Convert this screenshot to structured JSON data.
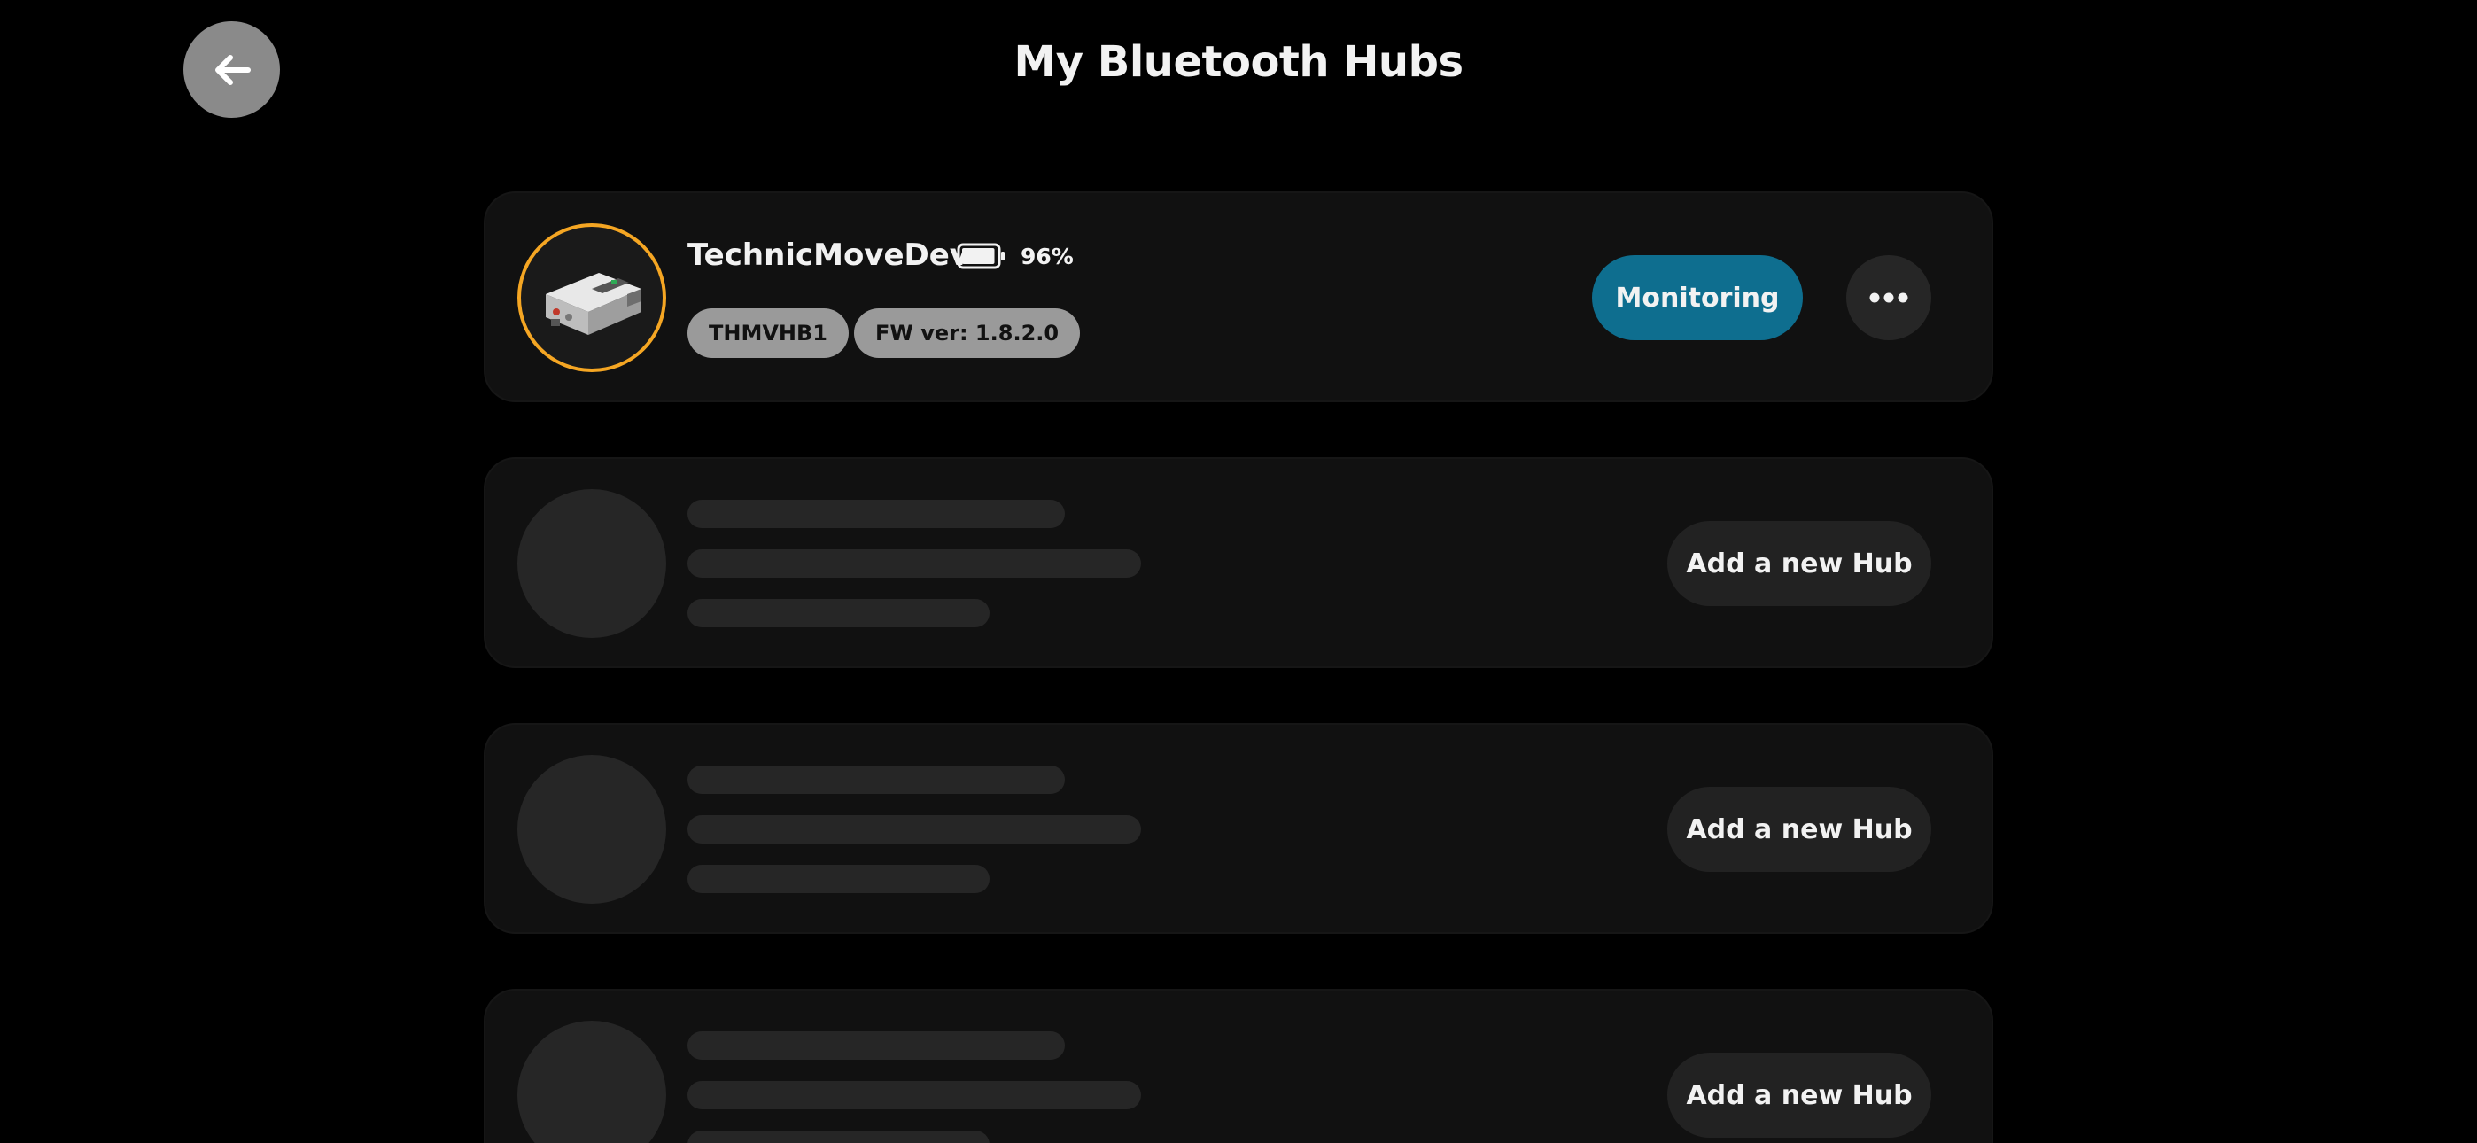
{
  "header": {
    "title": "My Bluetooth Hubs",
    "back_icon": "arrow-left-icon"
  },
  "connected_hub": {
    "name": "TechnicMoveDev",
    "battery_percent_label": "96%",
    "battery_level": 0.96,
    "serial_tag": "THMVHB1",
    "firmware_tag": "FW ver: 1.8.2.0",
    "monitoring_label": "Monitoring",
    "avatar_ring_color": "#f5a623",
    "monitoring_color": "#0e6e8f",
    "more_icon": "ellipsis-icon"
  },
  "empty_slots": [
    {
      "add_label": "Add a new Hub"
    },
    {
      "add_label": "Add a new Hub"
    },
    {
      "add_label": "Add a new Hub"
    }
  ]
}
